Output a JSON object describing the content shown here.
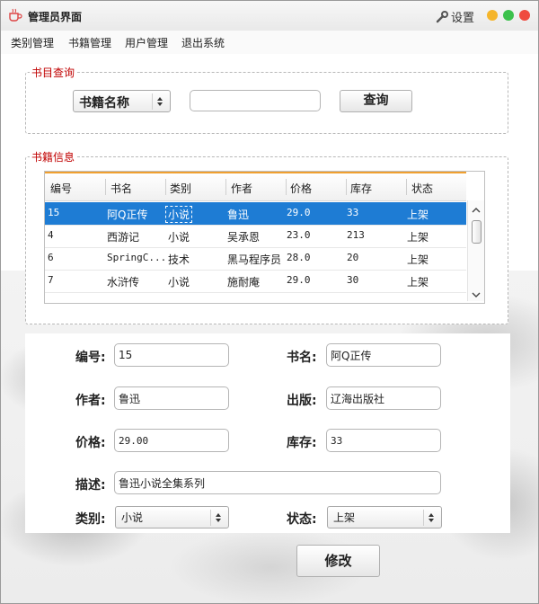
{
  "window": {
    "title": "管理员界面",
    "settings_label": "设置",
    "traffic_colors": [
      "#f5b52b",
      "#3cc14c",
      "#ef4b3f"
    ]
  },
  "menu": [
    "类别管理",
    "书籍管理",
    "用户管理",
    "退出系统"
  ],
  "query": {
    "group_title": "书目查询",
    "field_select": "书籍名称",
    "input_value": "",
    "search_button": "查询"
  },
  "table": {
    "group_title": "书籍信息",
    "columns": [
      "编号",
      "书名",
      "类别",
      "作者",
      "价格",
      "库存",
      "状态"
    ],
    "rows": [
      [
        "15",
        "阿Q正传",
        "小说",
        "鲁迅",
        "29.0",
        "33",
        "上架"
      ],
      [
        "4",
        "西游记",
        "小说",
        "吴承恩",
        "23.0",
        "213",
        "上架"
      ],
      [
        "6",
        "SpringC...",
        "技术",
        "黑马程序员",
        "28.0",
        "20",
        "上架"
      ],
      [
        "7",
        "水浒传",
        "小说",
        "施耐庵",
        "29.0",
        "30",
        "上架"
      ]
    ],
    "selected_row": 0
  },
  "form": {
    "id_label": "编号:",
    "id_value": "15",
    "name_label": "书名:",
    "name_value": "阿Q正传",
    "author_label": "作者:",
    "author_value": "鲁迅",
    "publisher_label": "出版:",
    "publisher_value": "辽海出版社",
    "price_label": "价格:",
    "price_value": "29.00",
    "stock_label": "库存:",
    "stock_value": "33",
    "desc_label": "描述:",
    "desc_value": "鲁迅小说全集系列",
    "category_label": "类别:",
    "category_value": "小说",
    "status_label": "状态:",
    "status_value": "上架",
    "modify_button": "修改"
  },
  "colors": {
    "selection": "#1e7cd4",
    "group_title": "#c00000",
    "header_accent": "#f0a030"
  }
}
